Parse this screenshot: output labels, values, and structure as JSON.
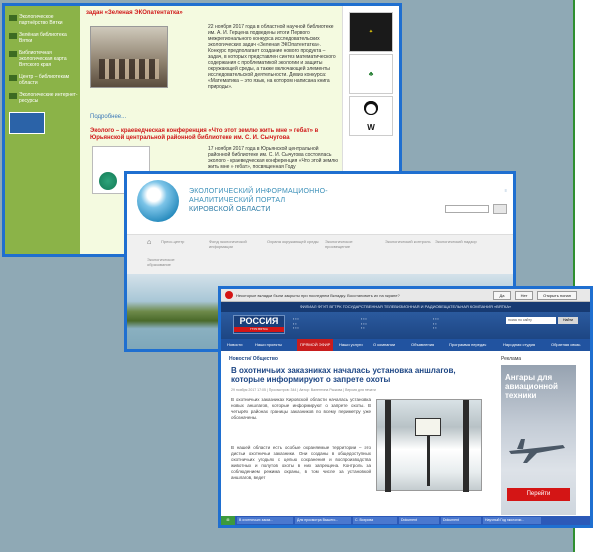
{
  "window_library": {
    "sidebar": [
      {
        "label": "Экологическое партнёрство Вятки"
      },
      {
        "label": "Зелёная библиотека Вятки"
      },
      {
        "label": "Библиотечная экологическая карта Вятского края"
      },
      {
        "label": "Центр – библиотекам области"
      },
      {
        "label": "Экологические интернет-ресурсы"
      }
    ],
    "headline_top": "задан «Зеленая ЭКОпатентатка»",
    "article_text": "22 ноября 2017 года в областной научной библиотеке им. А. И. Герцена подведены итоги Первого межрегионального конкурса исследовательских экологических задач «Зеленая ЭКОпатентатка». Конкурс предполагает создание нового продукта – задач, в которых представлен синтез математического содержания с проблематикой экологии и защиты окружающей среды, а также включающей элементы исследовательской деятельности. Девиз конкурса: «Математика – это язык, на котором написана книга природы».",
    "more_link": "Подробнее...",
    "conf_title": "Эколого – краеведческая конференция «Что этот землю жить мне » гебат» в Юрьянской центральной районной библиотеке им. С. И. Сычугова",
    "conf_text": "17 ноября 2017 года в Юрьянской центральной районной библиотеке им. С. И. Сычугова состоялась эколого - краеведческая конференция «Что этой землю жить мне » гебат», посвященная Году"
  },
  "window_portal": {
    "title_line1": "ЭКОЛОГИЧЕСКИЙ ИНФОРМАЦИОННО-",
    "title_line2": "АНАЛИТИЧЕСКИЙ ПОРТАЛ",
    "title_line3": "КИРОВСКОЙ ОБЛАСТИ",
    "nav": [
      {
        "label": "Пресс-центр"
      },
      {
        "label": "Фонд экологической информации"
      },
      {
        "label": "Охрана окружающей среды"
      },
      {
        "label": "Экологическое просвещение"
      },
      {
        "label": "Экологический контроль"
      },
      {
        "label": "Экологический надзор"
      },
      {
        "label": "Экологическое образование"
      }
    ]
  },
  "window_tv": {
    "browser_bar": "Некоторые вкладки были закрыты при последнем Вкладку. Восстановить их на экране?",
    "btn_yes": "Да",
    "btn_no": "Нет",
    "btn_more": "Открыть попап",
    "site_header": "ФИЛИАЛ ФГУП ВГТРК ГОСУДАРСТВЕННАЯ ТЕЛЕВИЗИОННАЯ И РАДИОВЕЩАТЕЛЬНАЯ КОМПАНИЯ «ВЯТКА»",
    "brand_name": "РОССИЯ",
    "brand_sub": "ГТРК ВЯТКА",
    "search_placeholder": "поиск по сайту",
    "search_btn": "Найти",
    "menu": [
      {
        "label": "Новости"
      },
      {
        "label": "Наши проекты"
      },
      {
        "label": "ПРЯМОЙ ЭФИР"
      },
      {
        "label": "Наши услуги"
      },
      {
        "label": "О компании"
      },
      {
        "label": "Объявления"
      },
      {
        "label": "Программа передач"
      },
      {
        "label": "Народная студия"
      },
      {
        "label": "Обратная связь"
      }
    ],
    "crumb": "Новости/ Общество",
    "headline": "В охотничьих заказниках началась установка аншлагов, которые информируют о запрете охоты",
    "meta": "29 ноября 2017 17:05 | Просмотров: 344 | Автор: Валентина Рыжова | Версия для печати",
    "para1": "В охотничьих заказниках Кировской области началась установка новых аншлагов, которые информируют о запрете охоты. В четырёх районах границы заказников по всему периметру уже обозначены.",
    "para2": "В нашей области есть особые охраняемые территории – это дистьи охотничьи заказники. Они созданы в общедоступных охотничьих угодьях с целью сохранения и воспроизводства животных и полутов охоты в них запрещена. Контроль за соблюдением режима охраны, в том числе за установкой аншлагов, ведет",
    "ad_label": "Реклама",
    "ad_headline": "Ангары для авиационной техники",
    "ad_button": "Перейти",
    "taskbar": [
      {
        "label": "В охотничьих заказ..."
      },
      {
        "label": "Для просмотра Вышего..."
      },
      {
        "label": "С. Вохрова"
      },
      {
        "label": "Dokument"
      },
      {
        "label": "Dokument"
      },
      {
        "label": "Научный Год экологии..."
      }
    ]
  }
}
